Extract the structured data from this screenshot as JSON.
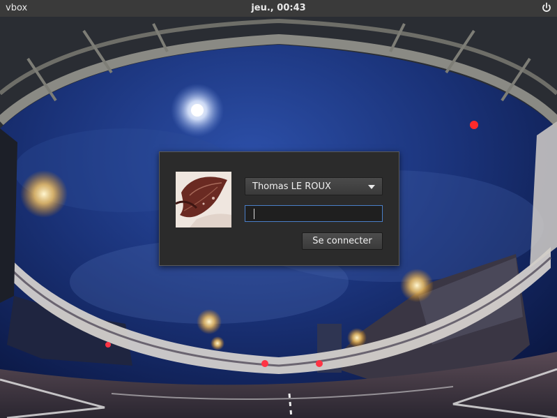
{
  "topbar": {
    "hostname": "vbox",
    "clock": "jeu., 00:43",
    "power_icon": "power-icon"
  },
  "login": {
    "selected_user": "Thomas LE ROUX",
    "password_value": "",
    "submit_label": "Se connecter",
    "avatar_icon": "autumn-leaf-avatar"
  },
  "colors": {
    "panel": "#3a3a3a",
    "dialog": "#2b2b2b",
    "focus_border": "#4a7fc8"
  }
}
